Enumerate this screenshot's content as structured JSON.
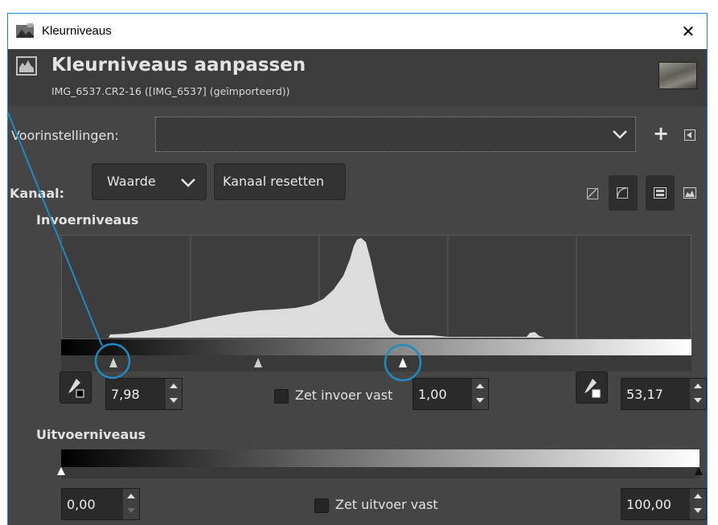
{
  "window": {
    "title": "Kleurniveaus",
    "close_glyph": "✕"
  },
  "header": {
    "title": "Kleurniveaus aanpassen",
    "subtitle": "IMG_6537.CR2-16 ([IMG_6537] (geïmporteerd))"
  },
  "presets": {
    "label": "Voorinstellingen:",
    "value": "",
    "add_icon": "plus-icon",
    "restore_icon": "restore-icon"
  },
  "channel": {
    "label": "Kanaal:",
    "selected": "Waarde",
    "reset_label": "Kanaal resetten",
    "scale_icons": [
      "linear-histogram-icon",
      "logarithmic-histogram-icon",
      "overlay-mode-icon",
      "histogram-view-icon"
    ]
  },
  "input_levels": {
    "heading": "Invoerniveaus",
    "low": "7,98",
    "gamma": "1,00",
    "high": "53,17",
    "clamp_label": "Zet invoer vast",
    "clamp_checked": false
  },
  "output_levels": {
    "heading": "Uitvoerniveaus",
    "low": "0,00",
    "high": "100,00",
    "clamp_label": "Zet uitvoer vast",
    "clamp_checked": false
  },
  "colors": {
    "annotation": "#1e8bc3",
    "bg": "#454545"
  }
}
